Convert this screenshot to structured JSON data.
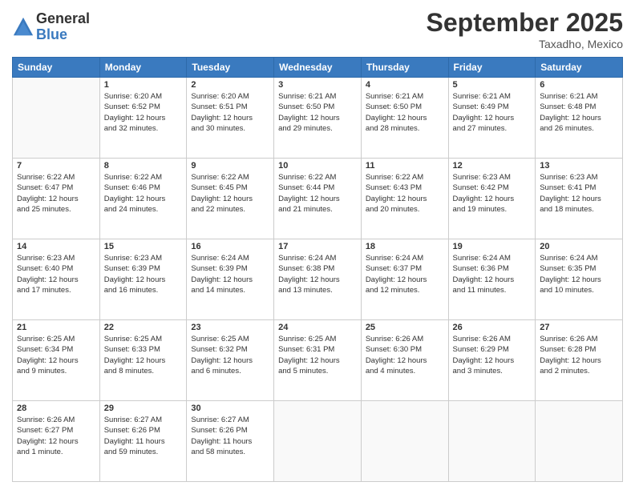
{
  "logo": {
    "general": "General",
    "blue": "Blue"
  },
  "header": {
    "month": "September 2025",
    "location": "Taxadho, Mexico"
  },
  "weekdays": [
    "Sunday",
    "Monday",
    "Tuesday",
    "Wednesday",
    "Thursday",
    "Friday",
    "Saturday"
  ],
  "weeks": [
    [
      {
        "day": "",
        "info": ""
      },
      {
        "day": "1",
        "info": "Sunrise: 6:20 AM\nSunset: 6:52 PM\nDaylight: 12 hours\nand 32 minutes."
      },
      {
        "day": "2",
        "info": "Sunrise: 6:20 AM\nSunset: 6:51 PM\nDaylight: 12 hours\nand 30 minutes."
      },
      {
        "day": "3",
        "info": "Sunrise: 6:21 AM\nSunset: 6:50 PM\nDaylight: 12 hours\nand 29 minutes."
      },
      {
        "day": "4",
        "info": "Sunrise: 6:21 AM\nSunset: 6:50 PM\nDaylight: 12 hours\nand 28 minutes."
      },
      {
        "day": "5",
        "info": "Sunrise: 6:21 AM\nSunset: 6:49 PM\nDaylight: 12 hours\nand 27 minutes."
      },
      {
        "day": "6",
        "info": "Sunrise: 6:21 AM\nSunset: 6:48 PM\nDaylight: 12 hours\nand 26 minutes."
      }
    ],
    [
      {
        "day": "7",
        "info": "Sunrise: 6:22 AM\nSunset: 6:47 PM\nDaylight: 12 hours\nand 25 minutes."
      },
      {
        "day": "8",
        "info": "Sunrise: 6:22 AM\nSunset: 6:46 PM\nDaylight: 12 hours\nand 24 minutes."
      },
      {
        "day": "9",
        "info": "Sunrise: 6:22 AM\nSunset: 6:45 PM\nDaylight: 12 hours\nand 22 minutes."
      },
      {
        "day": "10",
        "info": "Sunrise: 6:22 AM\nSunset: 6:44 PM\nDaylight: 12 hours\nand 21 minutes."
      },
      {
        "day": "11",
        "info": "Sunrise: 6:22 AM\nSunset: 6:43 PM\nDaylight: 12 hours\nand 20 minutes."
      },
      {
        "day": "12",
        "info": "Sunrise: 6:23 AM\nSunset: 6:42 PM\nDaylight: 12 hours\nand 19 minutes."
      },
      {
        "day": "13",
        "info": "Sunrise: 6:23 AM\nSunset: 6:41 PM\nDaylight: 12 hours\nand 18 minutes."
      }
    ],
    [
      {
        "day": "14",
        "info": "Sunrise: 6:23 AM\nSunset: 6:40 PM\nDaylight: 12 hours\nand 17 minutes."
      },
      {
        "day": "15",
        "info": "Sunrise: 6:23 AM\nSunset: 6:39 PM\nDaylight: 12 hours\nand 16 minutes."
      },
      {
        "day": "16",
        "info": "Sunrise: 6:24 AM\nSunset: 6:39 PM\nDaylight: 12 hours\nand 14 minutes."
      },
      {
        "day": "17",
        "info": "Sunrise: 6:24 AM\nSunset: 6:38 PM\nDaylight: 12 hours\nand 13 minutes."
      },
      {
        "day": "18",
        "info": "Sunrise: 6:24 AM\nSunset: 6:37 PM\nDaylight: 12 hours\nand 12 minutes."
      },
      {
        "day": "19",
        "info": "Sunrise: 6:24 AM\nSunset: 6:36 PM\nDaylight: 12 hours\nand 11 minutes."
      },
      {
        "day": "20",
        "info": "Sunrise: 6:24 AM\nSunset: 6:35 PM\nDaylight: 12 hours\nand 10 minutes."
      }
    ],
    [
      {
        "day": "21",
        "info": "Sunrise: 6:25 AM\nSunset: 6:34 PM\nDaylight: 12 hours\nand 9 minutes."
      },
      {
        "day": "22",
        "info": "Sunrise: 6:25 AM\nSunset: 6:33 PM\nDaylight: 12 hours\nand 8 minutes."
      },
      {
        "day": "23",
        "info": "Sunrise: 6:25 AM\nSunset: 6:32 PM\nDaylight: 12 hours\nand 6 minutes."
      },
      {
        "day": "24",
        "info": "Sunrise: 6:25 AM\nSunset: 6:31 PM\nDaylight: 12 hours\nand 5 minutes."
      },
      {
        "day": "25",
        "info": "Sunrise: 6:26 AM\nSunset: 6:30 PM\nDaylight: 12 hours\nand 4 minutes."
      },
      {
        "day": "26",
        "info": "Sunrise: 6:26 AM\nSunset: 6:29 PM\nDaylight: 12 hours\nand 3 minutes."
      },
      {
        "day": "27",
        "info": "Sunrise: 6:26 AM\nSunset: 6:28 PM\nDaylight: 12 hours\nand 2 minutes."
      }
    ],
    [
      {
        "day": "28",
        "info": "Sunrise: 6:26 AM\nSunset: 6:27 PM\nDaylight: 12 hours\nand 1 minute."
      },
      {
        "day": "29",
        "info": "Sunrise: 6:27 AM\nSunset: 6:26 PM\nDaylight: 11 hours\nand 59 minutes."
      },
      {
        "day": "30",
        "info": "Sunrise: 6:27 AM\nSunset: 6:26 PM\nDaylight: 11 hours\nand 58 minutes."
      },
      {
        "day": "",
        "info": ""
      },
      {
        "day": "",
        "info": ""
      },
      {
        "day": "",
        "info": ""
      },
      {
        "day": "",
        "info": ""
      }
    ]
  ]
}
